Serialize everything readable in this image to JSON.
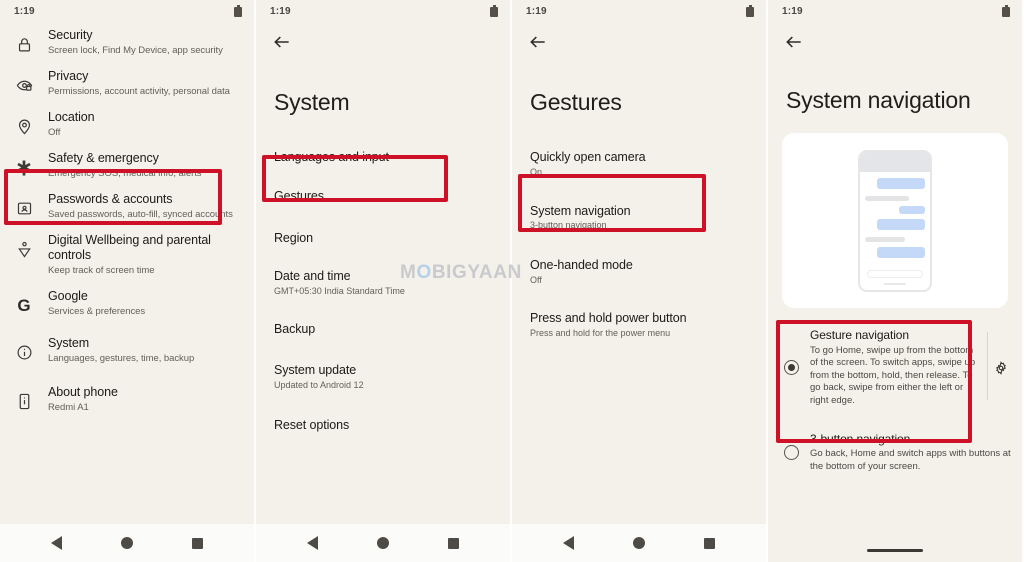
{
  "watermark": {
    "pre": "M",
    "o": "O",
    "post": "BIGYAAN"
  },
  "colors": {
    "highlight": "#ce1126",
    "background": "#f4f1ea",
    "card": "#ffffff",
    "accent_blue": "#c3d9f7"
  },
  "panels": [
    {
      "name": "settings-list",
      "status": {
        "time": "1:19",
        "battery_icon": "battery-icon"
      },
      "rows": [
        {
          "icon": "lock-icon",
          "title": "Security",
          "subtitle": "Screen lock, Find My Device, app security"
        },
        {
          "icon": "privacy-eye-icon",
          "title": "Privacy",
          "subtitle": "Permissions, account activity, personal data"
        },
        {
          "icon": "location-pin-icon",
          "title": "Location",
          "subtitle": "Off"
        },
        {
          "icon": "emergency-star-icon",
          "title": "Safety & emergency",
          "subtitle": "Emergency SOS, medical info, alerts"
        },
        {
          "icon": "passwords-accounts-icon",
          "title": "Passwords & accounts",
          "subtitle": "Saved passwords, auto-fill, synced accounts"
        },
        {
          "icon": "digital-wellbeing-icon",
          "title": "Digital Wellbeing and parental controls",
          "subtitle": "Keep track of screen time"
        },
        {
          "icon": "google-g-icon",
          "title": "Google",
          "subtitle": "Services & preferences"
        },
        {
          "icon": "info-circle-icon",
          "title": "System",
          "subtitle": "Languages, gestures, time, backup"
        },
        {
          "icon": "about-phone-icon",
          "title": "About phone",
          "subtitle": "Redmi A1"
        }
      ],
      "navbar": {
        "back": "nav-back-icon",
        "home": "nav-home-icon",
        "recents": "nav-recents-icon"
      }
    },
    {
      "name": "system-screen",
      "status": {
        "time": "1:19",
        "battery_icon": "battery-icon"
      },
      "back_icon": "back-arrow-icon",
      "title": "System",
      "rows": [
        {
          "title": "Languages and input",
          "subtitle": ""
        },
        {
          "title": "Gestures",
          "subtitle": ""
        },
        {
          "title": "Region",
          "subtitle": ""
        },
        {
          "title": "Date and time",
          "subtitle": "GMT+05:30 India Standard Time"
        },
        {
          "title": "Backup",
          "subtitle": ""
        },
        {
          "title": "System update",
          "subtitle": "Updated to Android 12"
        },
        {
          "title": "Reset options",
          "subtitle": ""
        }
      ],
      "navbar": {
        "back": "nav-back-icon",
        "home": "nav-home-icon",
        "recents": "nav-recents-icon"
      }
    },
    {
      "name": "gestures-screen",
      "status": {
        "time": "1:19",
        "battery_icon": "battery-icon"
      },
      "back_icon": "back-arrow-icon",
      "title": "Gestures",
      "rows": [
        {
          "title": "Quickly open camera",
          "subtitle": "On"
        },
        {
          "title": "System navigation",
          "subtitle": "3-button navigation"
        },
        {
          "title": "One-handed mode",
          "subtitle": "Off"
        },
        {
          "title": "Press and hold power button",
          "subtitle": "Press and hold for the power menu"
        }
      ],
      "navbar": {
        "back": "nav-back-icon",
        "home": "nav-home-icon",
        "recents": "nav-recents-icon"
      }
    },
    {
      "name": "system-navigation-screen",
      "status": {
        "time": "1:19",
        "battery_icon": "battery-icon"
      },
      "back_icon": "back-arrow-icon",
      "title": "System navigation",
      "preview": {
        "name": "navigation-preview-illustration"
      },
      "options": [
        {
          "title": "Gesture navigation",
          "description": "To go Home, swipe up from the bottom of the screen. To switch apps, swipe up from the bottom, hold, then release. To go back, swipe from either the left or right edge.",
          "selected": true,
          "gear_icon": "gear-icon"
        },
        {
          "title": "3-button navigation",
          "description": "Go back, Home and switch apps with buttons at the bottom of your screen.",
          "selected": false,
          "gear_icon": ""
        }
      ]
    }
  ]
}
